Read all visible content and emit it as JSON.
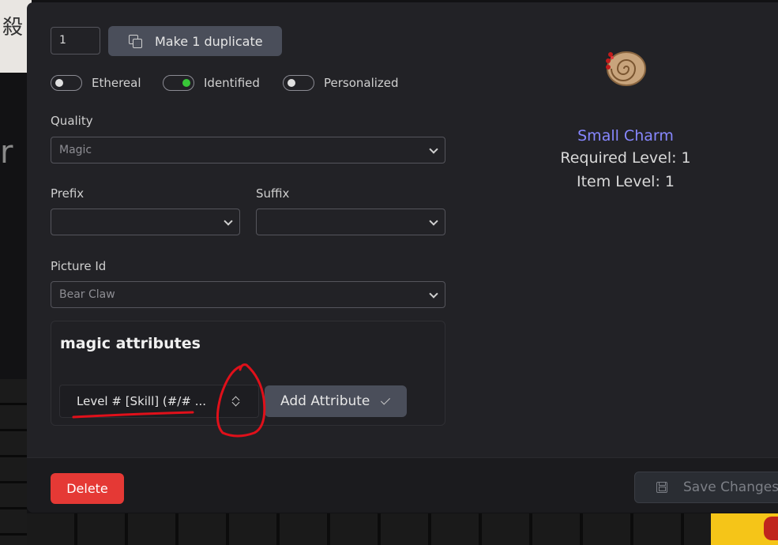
{
  "background": {
    "cjk_text": "殺",
    "fragment_text": "r fo"
  },
  "duplicate": {
    "quantity": "1",
    "button_label": "Make 1 duplicate"
  },
  "toggles": [
    {
      "label": "Ethereal",
      "on": false
    },
    {
      "label": "Identified",
      "on": true
    },
    {
      "label": "Personalized",
      "on": false
    }
  ],
  "quality": {
    "label": "Quality",
    "value": "Magic"
  },
  "prefix": {
    "label": "Prefix",
    "value": ""
  },
  "suffix": {
    "label": "Suffix",
    "value": ""
  },
  "picture": {
    "label": "Picture Id",
    "value": "Bear Claw"
  },
  "attributes": {
    "title": "magic attributes",
    "selected": "Level # [Skill] (#/# ...",
    "add_label": "Add Attribute"
  },
  "item": {
    "name": "Small Charm",
    "required_level": "Required Level: 1",
    "item_level": "Item Level: 1",
    "name_color": "#8787ff"
  },
  "footer": {
    "delete_label": "Delete",
    "save_label": "Save Changes"
  },
  "colors": {
    "accent_green": "#38c738",
    "danger": "#e53935",
    "annotation_red": "#e0101a"
  }
}
